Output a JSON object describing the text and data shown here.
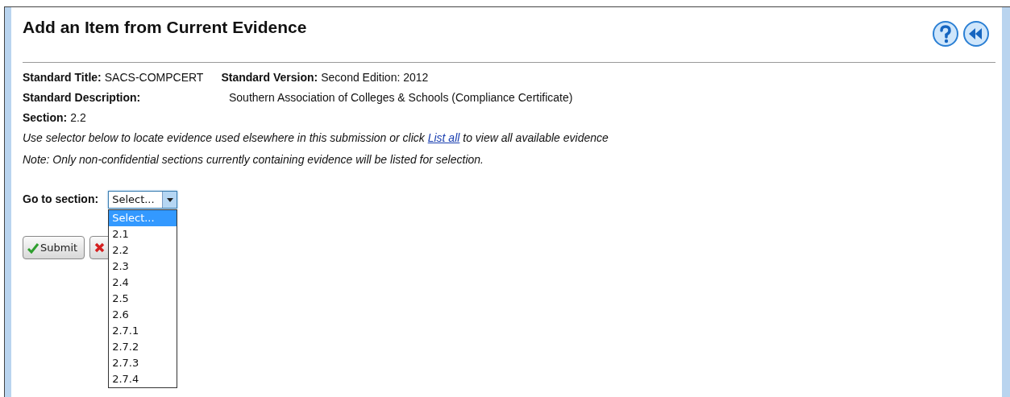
{
  "page": {
    "title": "Add an Item from Current Evidence"
  },
  "details": [
    {
      "label": "Standard Title:",
      "value": "SACS-COMPCERT",
      "label2": "Standard Version:",
      "value2": "Second Edition: 2012"
    },
    {
      "label": "Standard Description:",
      "value": "Southern Association of Colleges & Schools (Compliance Certificate)"
    },
    {
      "label": "Section:",
      "value": "2.2"
    }
  ],
  "instruction": {
    "before": "Use selector below to locate evidence used elsewhere in this submission or click",
    "link": "List all",
    "after": "to view all available evidence"
  },
  "note": "Note: Only non-confidential sections currently containing evidence will be listed for selection.",
  "section_select": {
    "label": "Go to section:",
    "value": "Select...",
    "expanded": true,
    "options": [
      {
        "label": "Select...",
        "selected": true
      },
      {
        "label": "2.1",
        "selected": false
      },
      {
        "label": "2.2",
        "selected": false
      },
      {
        "label": "2.3",
        "selected": false
      },
      {
        "label": "2.4",
        "selected": false
      },
      {
        "label": "2.5",
        "selected": false
      },
      {
        "label": "2.6",
        "selected": false
      },
      {
        "label": "2.7.1",
        "selected": false
      },
      {
        "label": "2.7.2",
        "selected": false
      },
      {
        "label": "2.7.3",
        "selected": false
      },
      {
        "label": "2.7.4",
        "selected": false
      }
    ]
  },
  "buttons": [
    {
      "kind": "submit",
      "label": "Submit"
    },
    {
      "kind": "cancel"
    }
  ]
}
